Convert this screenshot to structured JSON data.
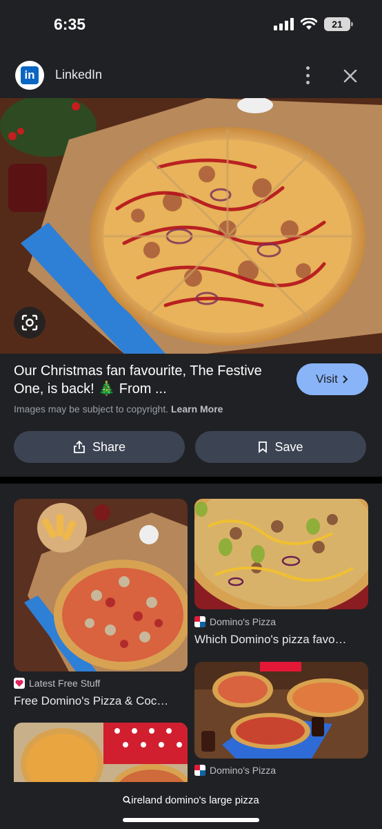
{
  "status": {
    "time": "6:35",
    "battery": "21"
  },
  "header": {
    "site_name": "LinkedIn",
    "logo_text": "in"
  },
  "detail": {
    "caption": "Our Christmas fan favourite, The Festive One, is back! 🎄 From ...",
    "visit_label": "Visit",
    "copyright_text": "Images may be subject to copyright.",
    "learn_more": "Learn More",
    "share_label": "Share",
    "save_label": "Save"
  },
  "results": [
    {
      "source": "Latest Free Stuff",
      "title": "Free Domino's Pizza & Coc…"
    },
    {
      "source": "Domino's Pizza",
      "title": "Which Domino's pizza favo…"
    },
    {
      "source": "Domino's Pizza",
      "title": ""
    }
  ],
  "bottom": {
    "query": "ireland domino's large pizza"
  },
  "colors": {
    "background": "#202124",
    "accent": "#8ab4f8",
    "button": "#3c4453",
    "linkedin": "#0a66c2"
  }
}
